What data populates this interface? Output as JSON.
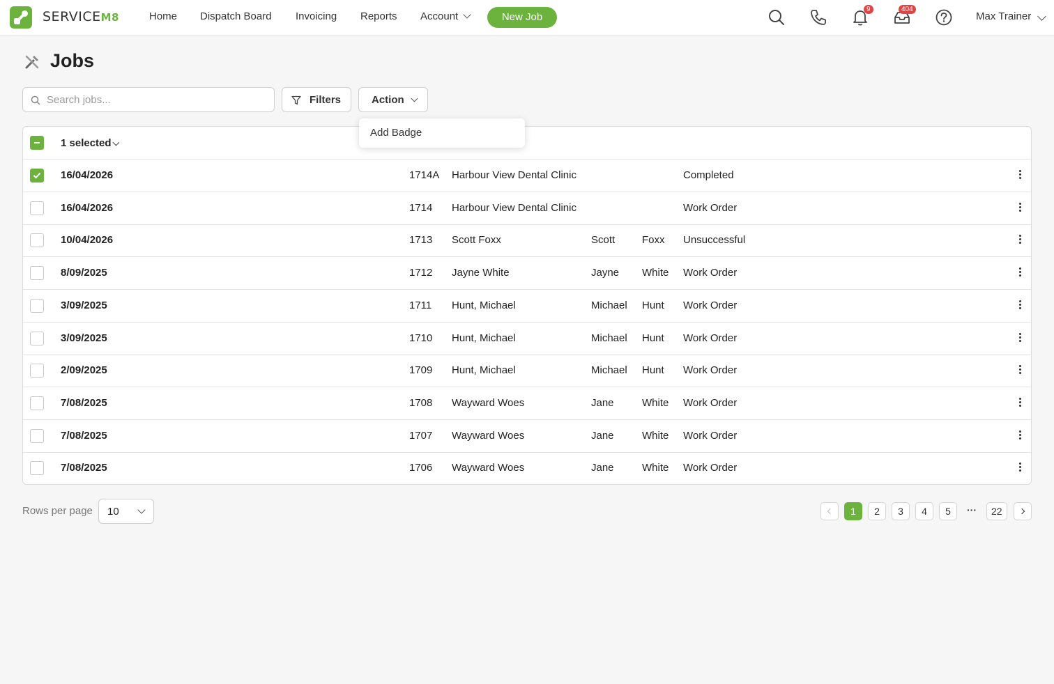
{
  "brand": {
    "name_prefix": "SERVICE",
    "name_suffix": "M8",
    "accent": "#6cb33e"
  },
  "nav": {
    "items": [
      {
        "label": "Home"
      },
      {
        "label": "Dispatch Board"
      },
      {
        "label": "Invoicing"
      },
      {
        "label": "Reports"
      },
      {
        "label": "Account"
      }
    ],
    "new_job": "New Job",
    "notifications_count": "9",
    "inbox_count": "404",
    "user_name": "Max Trainer"
  },
  "page": {
    "title": "Jobs"
  },
  "toolbar": {
    "search_placeholder": "Search jobs...",
    "filters_label": "Filters",
    "action_label": "Action",
    "action_menu": [
      "Add Badge"
    ]
  },
  "table": {
    "selected_label": "1 selected",
    "rows": [
      {
        "date": "16/04/2026",
        "number": "1714A",
        "client": "Harbour View Dental Clinic",
        "first": "",
        "last": "",
        "status": "Completed",
        "checked": true
      },
      {
        "date": "16/04/2026",
        "number": "1714",
        "client": "Harbour View Dental Clinic",
        "first": "",
        "last": "",
        "status": "Work Order",
        "checked": false
      },
      {
        "date": "10/04/2026",
        "number": "1713",
        "client": "Scott Foxx",
        "first": "Scott",
        "last": "Foxx",
        "status": "Unsuccessful",
        "checked": false
      },
      {
        "date": "8/09/2025",
        "number": "1712",
        "client": "Jayne White",
        "first": "Jayne",
        "last": "White",
        "status": "Work Order",
        "checked": false
      },
      {
        "date": "3/09/2025",
        "number": "1711",
        "client": "Hunt, Michael",
        "first": "Michael",
        "last": "Hunt",
        "status": "Work Order",
        "checked": false
      },
      {
        "date": "3/09/2025",
        "number": "1710",
        "client": "Hunt, Michael",
        "first": "Michael",
        "last": "Hunt",
        "status": "Work Order",
        "checked": false
      },
      {
        "date": "2/09/2025",
        "number": "1709",
        "client": "Hunt, Michael",
        "first": "Michael",
        "last": "Hunt",
        "status": "Work Order",
        "checked": false
      },
      {
        "date": "7/08/2025",
        "number": "1708",
        "client": "Wayward Woes",
        "first": "Jane",
        "last": "White",
        "status": "Work Order",
        "checked": false
      },
      {
        "date": "7/08/2025",
        "number": "1707",
        "client": "Wayward Woes",
        "first": "Jane",
        "last": "White",
        "status": "Work Order",
        "checked": false
      },
      {
        "date": "7/08/2025",
        "number": "1706",
        "client": "Wayward Woes",
        "first": "Jane",
        "last": "White",
        "status": "Work Order",
        "checked": false
      }
    ]
  },
  "footer": {
    "rows_per_page_label": "Rows per page",
    "rows_per_page_value": "10",
    "pages": [
      "1",
      "2",
      "3",
      "4",
      "5"
    ],
    "ellipsis": "···",
    "last_page": "22",
    "current_page": "1"
  }
}
